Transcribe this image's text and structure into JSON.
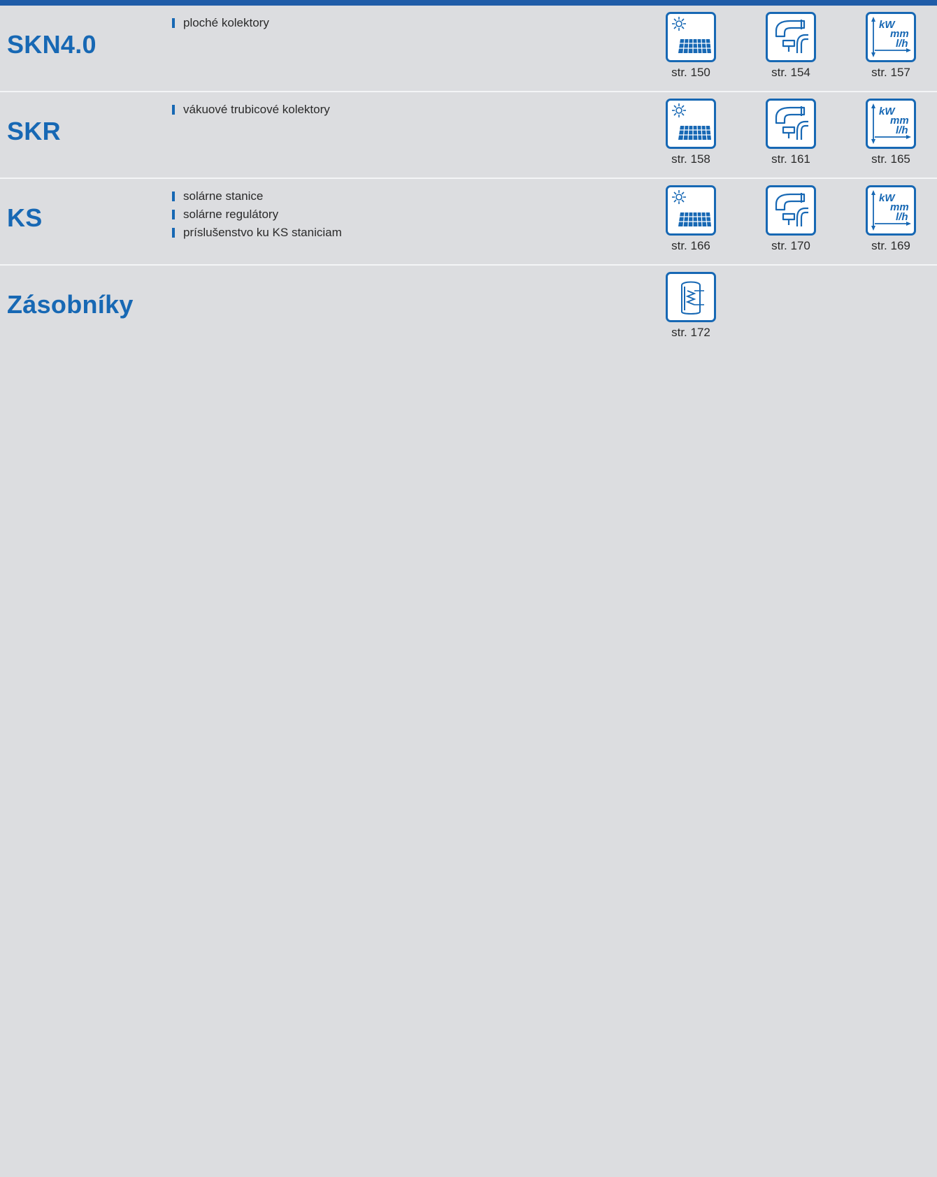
{
  "colors": {
    "accent": "#1768b4",
    "background": "#dcdde0",
    "divider": "#f4f5f7"
  },
  "rows": [
    {
      "title": "SKN4.0",
      "bullets": [
        "ploché kolektory"
      ],
      "icons": [
        {
          "icon": "solar-panel-icon",
          "page": "str. 150"
        },
        {
          "icon": "pipe-connection-icon",
          "page": "str. 154"
        },
        {
          "icon": "technical-data-icon",
          "page": "str. 157"
        }
      ]
    },
    {
      "title": "SKR",
      "bullets": [
        "vákuové trubicové kolektory"
      ],
      "icons": [
        {
          "icon": "solar-panel-icon",
          "page": "str. 158"
        },
        {
          "icon": "pipe-connection-icon",
          "page": "str. 161"
        },
        {
          "icon": "technical-data-icon",
          "page": "str. 165"
        }
      ]
    },
    {
      "title": "KS",
      "bullets": [
        "solárne stanice",
        "solárne regulátory",
        "príslušenstvo ku KS staniciam"
      ],
      "icons": [
        {
          "icon": "solar-panel-icon",
          "page": "str. 166"
        },
        {
          "icon": "pipe-connection-icon",
          "page": "str. 170"
        },
        {
          "icon": "technical-data-icon",
          "page": "str. 169"
        }
      ]
    },
    {
      "title": "Zásobníky",
      "bullets": [],
      "icons": [
        {
          "icon": "storage-tank-icon",
          "page": "str. 172"
        }
      ]
    }
  ],
  "icon_text": {
    "kw": "kW",
    "mm": "mm",
    "lh": "l/h"
  }
}
